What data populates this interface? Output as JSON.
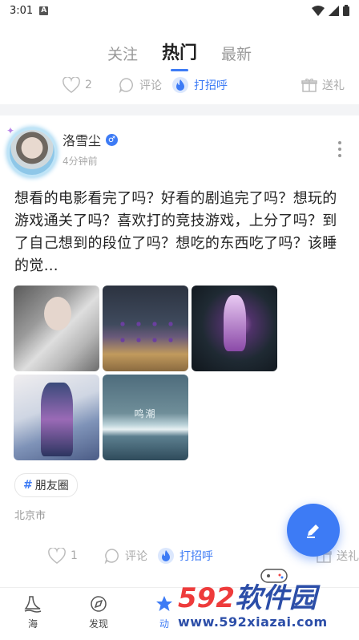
{
  "status_bar": {
    "time": "3:01",
    "notif_badge": "A"
  },
  "top_tabs": [
    {
      "label": "关注",
      "active": false
    },
    {
      "label": "热门",
      "active": true
    },
    {
      "label": "最新",
      "active": false
    }
  ],
  "prev_post_actions": {
    "like_count": "2",
    "comment_label": "评论",
    "greet_label": "打招呼",
    "gift_label": "送礼"
  },
  "post": {
    "username": "洛雪尘",
    "gender_symbol": "♂",
    "time": "4分钟前",
    "content": "想看的电影看完了吗？好看的剧追完了吗？想玩的游戏通关了吗？喜欢打的竞技游戏，上分了吗？到了自己想到的段位了吗？想吃的东西吃了吗？该睡的觉…",
    "image_caption": "鸣潮",
    "tag": "朋友圈",
    "tag_hash": "#",
    "location": "北京市",
    "actions": {
      "like_count": "1",
      "comment_label": "评论",
      "greet_label": "打招呼",
      "gift_label": "送礼"
    }
  },
  "bottom_nav": [
    {
      "label": "海",
      "icon": "sea-icon",
      "active": false
    },
    {
      "label": "发现",
      "icon": "discover-icon",
      "active": false
    },
    {
      "label": "动",
      "icon": "feed-star-icon",
      "active": true
    }
  ],
  "watermark": {
    "brand_num": "592",
    "brand_text": "软件园",
    "url": "www.592xiazai.com"
  },
  "colors": {
    "accent": "#3d7bf5",
    "muted": "#aaaaaa",
    "separator": "#f3f4f6"
  }
}
